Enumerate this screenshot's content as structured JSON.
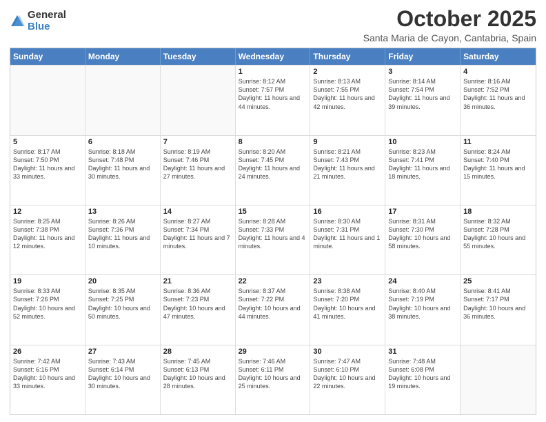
{
  "logo": {
    "general": "General",
    "blue": "Blue"
  },
  "header": {
    "month": "October 2025",
    "location": "Santa Maria de Cayon, Cantabria, Spain"
  },
  "weekdays": [
    "Sunday",
    "Monday",
    "Tuesday",
    "Wednesday",
    "Thursday",
    "Friday",
    "Saturday"
  ],
  "rows": [
    [
      {
        "date": "",
        "info": ""
      },
      {
        "date": "",
        "info": ""
      },
      {
        "date": "",
        "info": ""
      },
      {
        "date": "1",
        "info": "Sunrise: 8:12 AM\nSunset: 7:57 PM\nDaylight: 11 hours and 44 minutes."
      },
      {
        "date": "2",
        "info": "Sunrise: 8:13 AM\nSunset: 7:55 PM\nDaylight: 11 hours and 42 minutes."
      },
      {
        "date": "3",
        "info": "Sunrise: 8:14 AM\nSunset: 7:54 PM\nDaylight: 11 hours and 39 minutes."
      },
      {
        "date": "4",
        "info": "Sunrise: 8:16 AM\nSunset: 7:52 PM\nDaylight: 11 hours and 36 minutes."
      }
    ],
    [
      {
        "date": "5",
        "info": "Sunrise: 8:17 AM\nSunset: 7:50 PM\nDaylight: 11 hours and 33 minutes."
      },
      {
        "date": "6",
        "info": "Sunrise: 8:18 AM\nSunset: 7:48 PM\nDaylight: 11 hours and 30 minutes."
      },
      {
        "date": "7",
        "info": "Sunrise: 8:19 AM\nSunset: 7:46 PM\nDaylight: 11 hours and 27 minutes."
      },
      {
        "date": "8",
        "info": "Sunrise: 8:20 AM\nSunset: 7:45 PM\nDaylight: 11 hours and 24 minutes."
      },
      {
        "date": "9",
        "info": "Sunrise: 8:21 AM\nSunset: 7:43 PM\nDaylight: 11 hours and 21 minutes."
      },
      {
        "date": "10",
        "info": "Sunrise: 8:23 AM\nSunset: 7:41 PM\nDaylight: 11 hours and 18 minutes."
      },
      {
        "date": "11",
        "info": "Sunrise: 8:24 AM\nSunset: 7:40 PM\nDaylight: 11 hours and 15 minutes."
      }
    ],
    [
      {
        "date": "12",
        "info": "Sunrise: 8:25 AM\nSunset: 7:38 PM\nDaylight: 11 hours and 12 minutes."
      },
      {
        "date": "13",
        "info": "Sunrise: 8:26 AM\nSunset: 7:36 PM\nDaylight: 11 hours and 10 minutes."
      },
      {
        "date": "14",
        "info": "Sunrise: 8:27 AM\nSunset: 7:34 PM\nDaylight: 11 hours and 7 minutes."
      },
      {
        "date": "15",
        "info": "Sunrise: 8:28 AM\nSunset: 7:33 PM\nDaylight: 11 hours and 4 minutes."
      },
      {
        "date": "16",
        "info": "Sunrise: 8:30 AM\nSunset: 7:31 PM\nDaylight: 11 hours and 1 minute."
      },
      {
        "date": "17",
        "info": "Sunrise: 8:31 AM\nSunset: 7:30 PM\nDaylight: 10 hours and 58 minutes."
      },
      {
        "date": "18",
        "info": "Sunrise: 8:32 AM\nSunset: 7:28 PM\nDaylight: 10 hours and 55 minutes."
      }
    ],
    [
      {
        "date": "19",
        "info": "Sunrise: 8:33 AM\nSunset: 7:26 PM\nDaylight: 10 hours and 52 minutes."
      },
      {
        "date": "20",
        "info": "Sunrise: 8:35 AM\nSunset: 7:25 PM\nDaylight: 10 hours and 50 minutes."
      },
      {
        "date": "21",
        "info": "Sunrise: 8:36 AM\nSunset: 7:23 PM\nDaylight: 10 hours and 47 minutes."
      },
      {
        "date": "22",
        "info": "Sunrise: 8:37 AM\nSunset: 7:22 PM\nDaylight: 10 hours and 44 minutes."
      },
      {
        "date": "23",
        "info": "Sunrise: 8:38 AM\nSunset: 7:20 PM\nDaylight: 10 hours and 41 minutes."
      },
      {
        "date": "24",
        "info": "Sunrise: 8:40 AM\nSunset: 7:19 PM\nDaylight: 10 hours and 38 minutes."
      },
      {
        "date": "25",
        "info": "Sunrise: 8:41 AM\nSunset: 7:17 PM\nDaylight: 10 hours and 36 minutes."
      }
    ],
    [
      {
        "date": "26",
        "info": "Sunrise: 7:42 AM\nSunset: 6:16 PM\nDaylight: 10 hours and 33 minutes."
      },
      {
        "date": "27",
        "info": "Sunrise: 7:43 AM\nSunset: 6:14 PM\nDaylight: 10 hours and 30 minutes."
      },
      {
        "date": "28",
        "info": "Sunrise: 7:45 AM\nSunset: 6:13 PM\nDaylight: 10 hours and 28 minutes."
      },
      {
        "date": "29",
        "info": "Sunrise: 7:46 AM\nSunset: 6:11 PM\nDaylight: 10 hours and 25 minutes."
      },
      {
        "date": "30",
        "info": "Sunrise: 7:47 AM\nSunset: 6:10 PM\nDaylight: 10 hours and 22 minutes."
      },
      {
        "date": "31",
        "info": "Sunrise: 7:48 AM\nSunset: 6:08 PM\nDaylight: 10 hours and 19 minutes."
      },
      {
        "date": "",
        "info": ""
      }
    ]
  ]
}
